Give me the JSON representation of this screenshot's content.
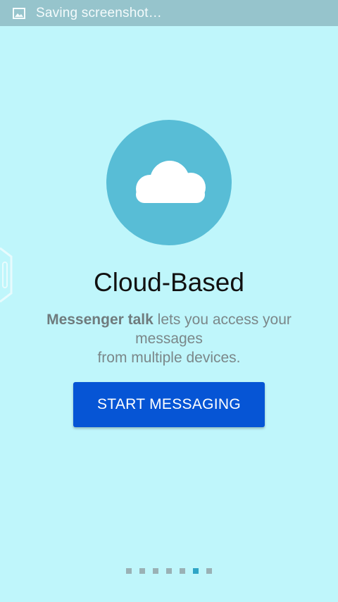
{
  "status_bar": {
    "icon": "image-icon",
    "text": "Saving screenshot…"
  },
  "onboarding": {
    "illustration_icon": "cloud-icon",
    "title": "Cloud-Based",
    "description_brand": "Messenger talk",
    "description_line1_rest": " lets you access your",
    "description_line2": "messages",
    "description_line3": "from multiple devices.",
    "cta_label": "START MESSAGING"
  },
  "pager": {
    "total_pages": 7,
    "current_page": 6
  },
  "colors": {
    "background": "#bff6fb",
    "status_bar": "#96c4cc",
    "circle": "#58bdd6",
    "button": "#0655d5",
    "dot_inactive": "#9ab1b5",
    "dot_active": "#2fa5c6"
  }
}
